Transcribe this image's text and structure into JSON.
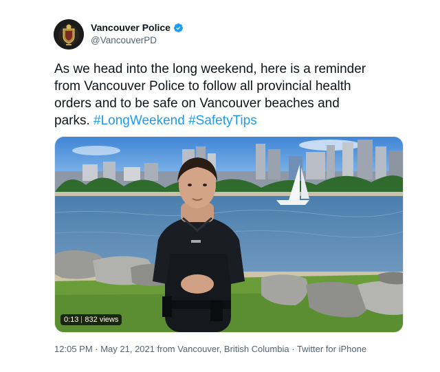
{
  "author": {
    "display_name": "Vancouver Police",
    "handle": "@VancouverPD",
    "verified": true,
    "avatar_icon": "police-crest-icon"
  },
  "tweet": {
    "text": "As we head into the long weekend, here is a reminder\nfrom Vancouver Police to follow all provincial health\norders and to be safe on Vancouver beaches and\nparks. ",
    "hashtags": [
      "#LongWeekend",
      "#SafetyTips"
    ]
  },
  "video": {
    "duration": "0:13",
    "views": "832 views"
  },
  "meta": {
    "time": "12:05 PM",
    "date": "May 21, 2021",
    "location": "from Vancouver, British Columbia",
    "client": "Twitter for iPhone",
    "separator": " · "
  },
  "colors": {
    "accent": "#1d9bf0",
    "text_primary": "#0f1419",
    "text_secondary": "#536471"
  }
}
